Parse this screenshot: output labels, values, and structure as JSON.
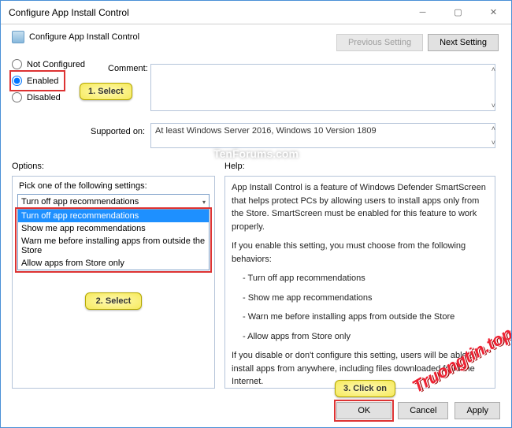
{
  "titlebar": {
    "title": "Configure App Install Control"
  },
  "subtitle": {
    "label": "Configure App Install Control"
  },
  "nav": {
    "prev": "Previous Setting",
    "next": "Next Setting"
  },
  "radios": {
    "not_configured": "Not Configured",
    "enabled": "Enabled",
    "disabled": "Disabled"
  },
  "labels": {
    "comment": "Comment:",
    "supported": "Supported on:",
    "options": "Options:",
    "help": "Help:",
    "pick": "Pick one of the following settings:"
  },
  "supported_text": "At least Windows Server 2016, Windows 10 Version 1809",
  "dropdown": {
    "selected": "Turn off app recommendations",
    "items": [
      "Turn off app recommendations",
      "Show me app recommendations",
      "Warn me before installing apps from outside the Store",
      "Allow apps from Store only"
    ]
  },
  "help": {
    "p1": "App Install Control is a feature of Windows Defender SmartScreen that helps protect PCs by allowing users to install apps only from the Store. SmartScreen must be enabled for this feature to work properly.",
    "p2": "If you enable this setting, you must choose from the following behaviors:",
    "b1": "- Turn off app recommendations",
    "b2": "- Show me app recommendations",
    "b3": "- Warn me before installing apps from outside the Store",
    "b4": "- Allow apps from Store only",
    "p3": "If you disable or don't configure this setting, users will be able to install apps from anywhere, including files downloaded from the Internet."
  },
  "buttons": {
    "ok": "OK",
    "cancel": "Cancel",
    "apply": "Apply"
  },
  "callouts": {
    "c1": "1. Select",
    "c2": "2. Select",
    "c3": "3. Click on"
  },
  "watermarks": {
    "w1": "TenForums.com",
    "w2": "Truongtin.top"
  }
}
